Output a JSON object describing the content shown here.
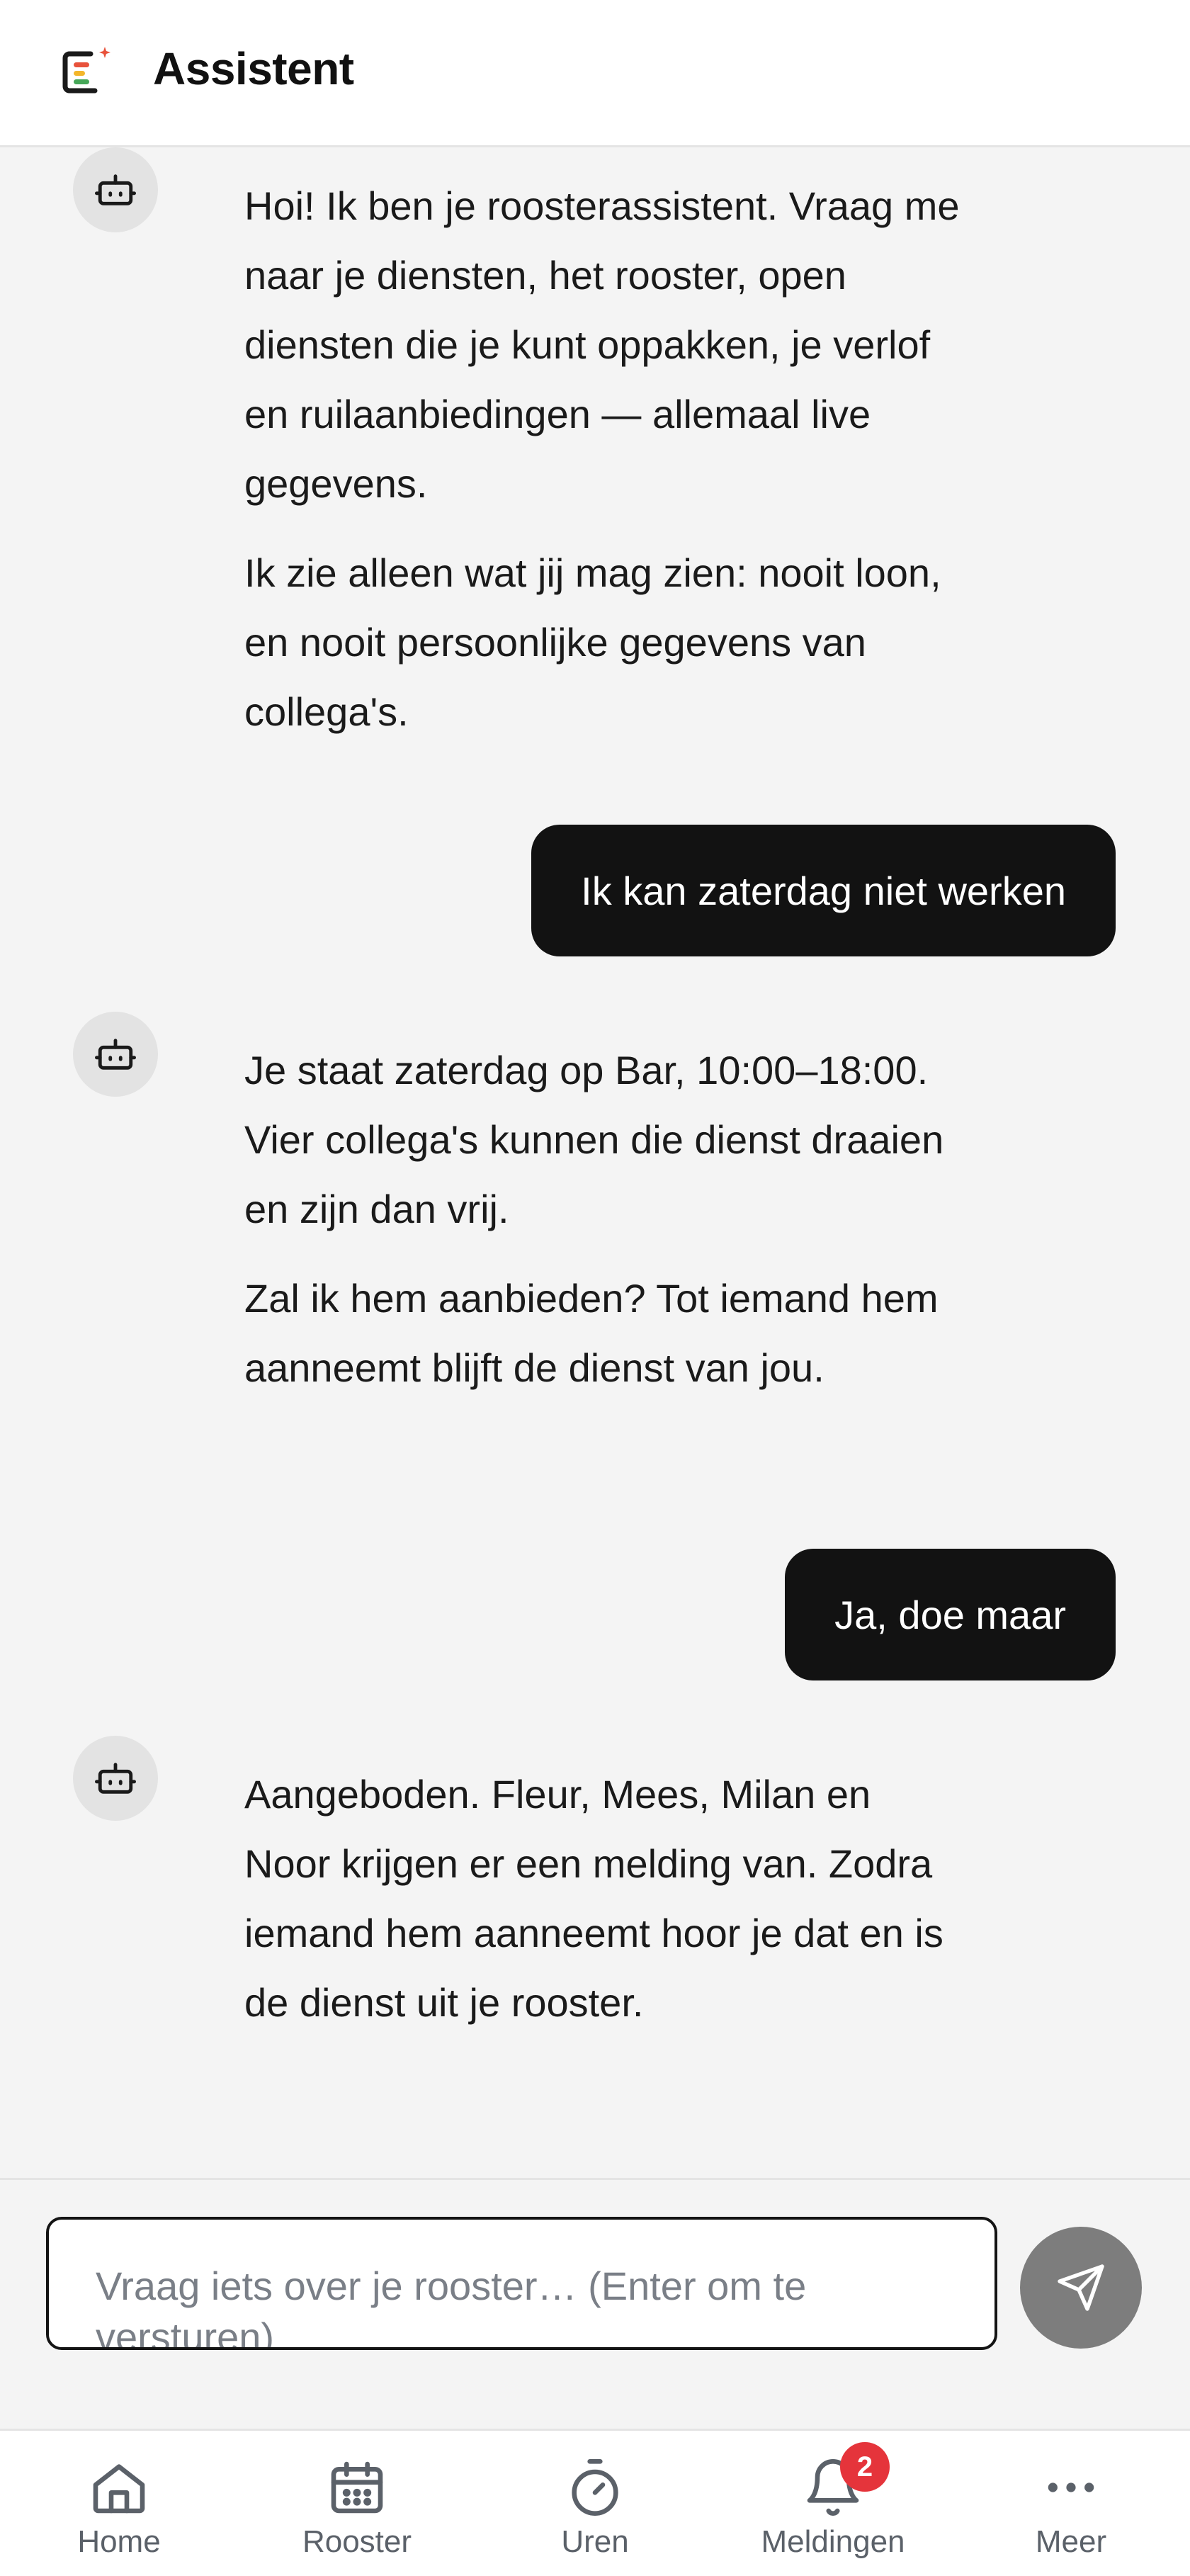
{
  "header": {
    "title": "Assistent",
    "logo_icon": "app-logo-icon"
  },
  "colors": {
    "user_bubble": "#121212",
    "send_button": "#7d7d7d",
    "badge": "#e5343b",
    "logo_orange": "#e8523b",
    "logo_yellow": "#f3b62b",
    "logo_green": "#46a758"
  },
  "chat": {
    "messages": [
      {
        "role": "assistant",
        "paragraphs": [
          "Hoi! Ik ben je roosterassistent. Vraag me naar je diensten, het rooster, open diensten die je kunt oppakken, je verlof en ruilaanbiedingen — allemaal live gegevens.",
          "Ik zie alleen wat jij mag zien: nooit loon, en nooit persoonlijke gegevens van collega's."
        ]
      },
      {
        "role": "user",
        "text": "Ik kan zaterdag niet werken"
      },
      {
        "role": "assistant",
        "paragraphs": [
          "Je staat zaterdag op Bar, 10:00–18:00. Vier collega's kunnen die dienst draaien en zijn dan vrij.",
          "Zal ik hem aanbieden? Tot iemand hem aanneemt blijft de dienst van jou."
        ]
      },
      {
        "role": "user",
        "text": "Ja, doe maar"
      },
      {
        "role": "assistant",
        "paragraphs": [
          "Aangeboden. Fleur, Mees, Milan en Noor krijgen er een melding van. Zodra iemand hem aanneemt hoor je dat en is de dienst uit je rooster."
        ]
      }
    ]
  },
  "composer": {
    "placeholder": "Vraag iets over je rooster… (Enter om te versturen)",
    "send_icon": "send-icon"
  },
  "nav": {
    "items": [
      {
        "label": "Home",
        "icon": "home-icon"
      },
      {
        "label": "Rooster",
        "icon": "calendar-icon"
      },
      {
        "label": "Uren",
        "icon": "stopwatch-icon"
      },
      {
        "label": "Meldingen",
        "icon": "bell-icon",
        "badge": "2"
      },
      {
        "label": "Meer",
        "icon": "more-icon"
      }
    ]
  }
}
